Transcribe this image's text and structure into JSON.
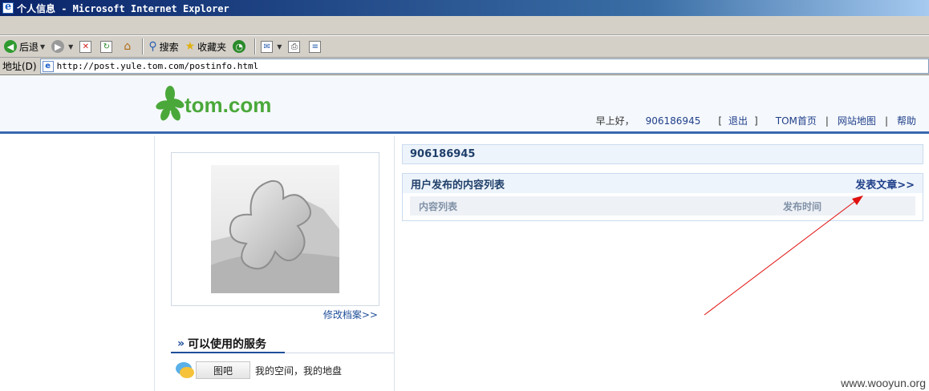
{
  "window": {
    "title": "个人信息 - Microsoft Internet Explorer"
  },
  "toolbar": {
    "back_label": "后退",
    "search_label": "搜索",
    "favorites_label": "收藏夹"
  },
  "address": {
    "label": "地址(D)",
    "url": "http://post.yule.tom.com/postinfo.html"
  },
  "site": {
    "logo_text": "tom.com",
    "greeting": "早上好，",
    "username": "906186945",
    "bracket_open": "[",
    "logout": "退出",
    "bracket_close": "]",
    "nav": [
      "TOM首页",
      "网站地图",
      "帮助"
    ]
  },
  "sidebar": {
    "edit_profile": "修改档案>>",
    "services_title": "可以使用的服务",
    "service_button": "图吧",
    "service_desc": "我的空间，我的地盘"
  },
  "main": {
    "user_header": "906186945",
    "panel_title": "用户发布的内容列表",
    "post_link": "发表文章>>",
    "columns": [
      "内容列表",
      "发布时间"
    ]
  },
  "watermark": "www.wooyun.org",
  "colors": {
    "brand_green": "#4aa83a",
    "link_blue": "#1f3f8a",
    "annotation_red": "#e01010"
  }
}
